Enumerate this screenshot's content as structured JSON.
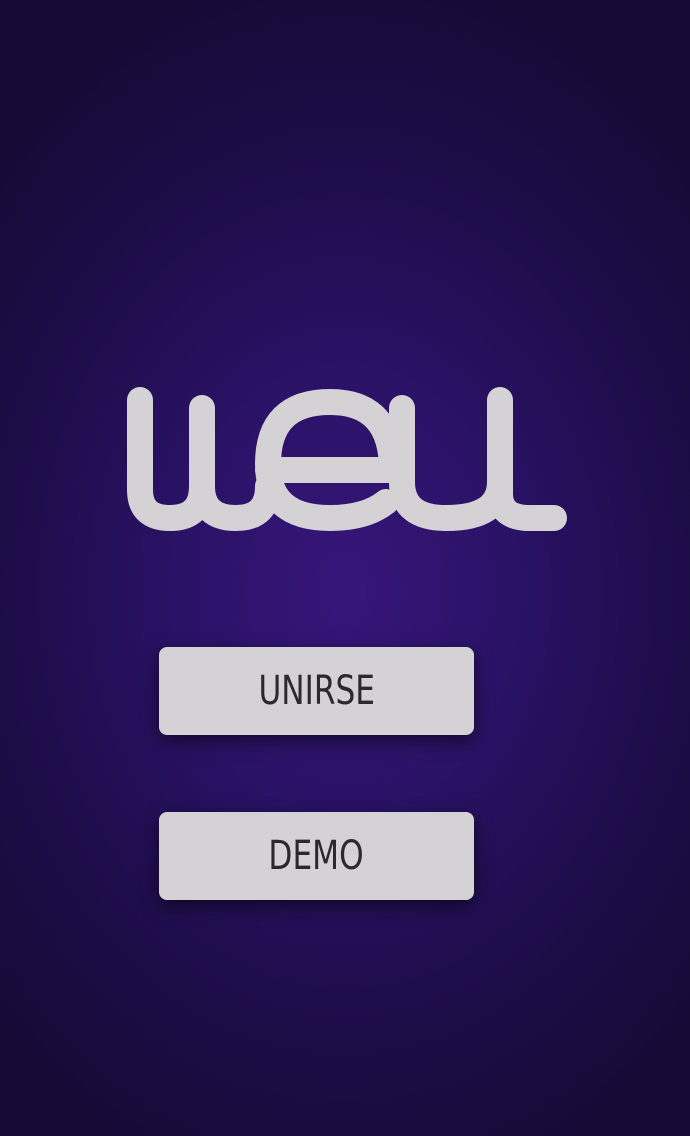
{
  "app": {
    "logo_text": "weu",
    "logo_color": "#d4d2d4"
  },
  "actions": {
    "join_label": "UNIRSE",
    "demo_label": "DEMO"
  },
  "colors": {
    "background_center": "#37167a",
    "background_edge": "#170a36",
    "button_bg": "#d4d2d4",
    "button_text": "#2a2a2a"
  }
}
